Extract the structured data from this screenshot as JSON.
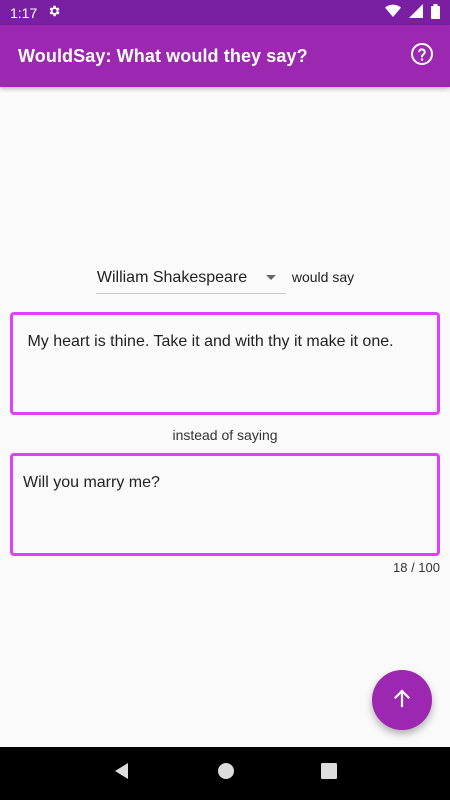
{
  "status_bar": {
    "time": "1:17",
    "icons": [
      "gear-icon",
      "wifi-icon",
      "signal-icon",
      "battery-icon"
    ]
  },
  "app_bar": {
    "title": "WouldSay: What would they say?",
    "help_icon": "help-circle-icon",
    "color": "#9c27b0"
  },
  "selector": {
    "selected_person": "William Shakespeare",
    "suffix": "would say"
  },
  "output": {
    "text": " My heart is thine. Take it and with thy it make it one."
  },
  "instead_label": "instead of saying",
  "input": {
    "value": "Will you marry me?",
    "counter": "18 / 100"
  },
  "fab": {
    "icon": "arrow-up-icon"
  },
  "nav_bar": {
    "icons": [
      "back-icon",
      "home-icon",
      "recents-icon"
    ]
  },
  "colors": {
    "accent": "#e040fb",
    "primary": "#9c27b0",
    "primary_dark": "#7b1fa2"
  }
}
